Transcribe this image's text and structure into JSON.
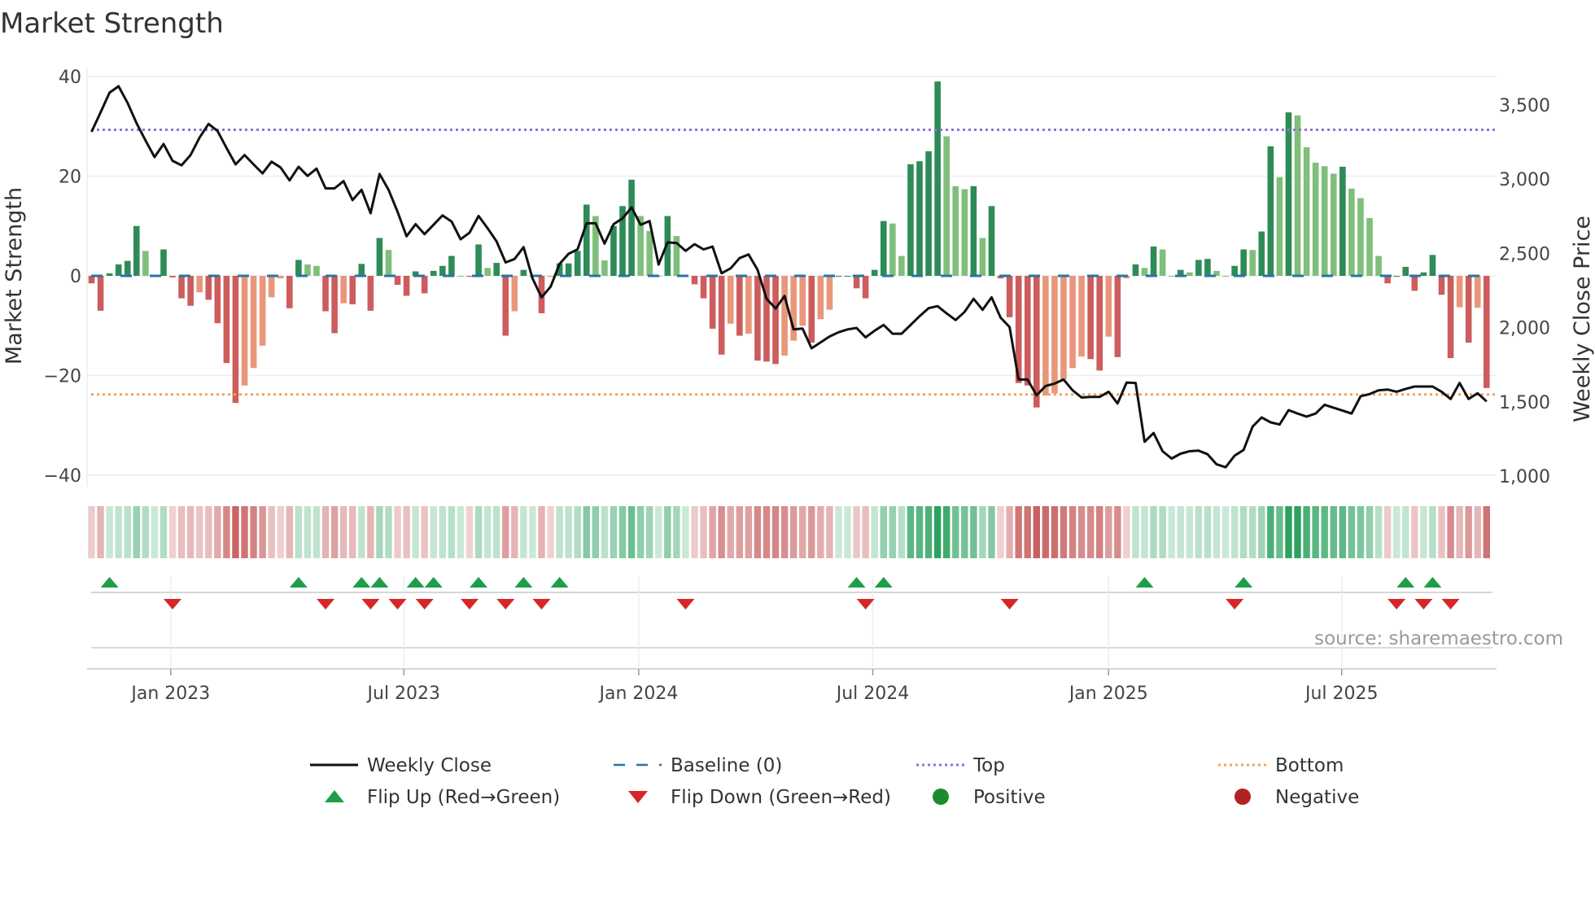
{
  "title": "Market Strength",
  "source": "source: sharemaestro.com",
  "colors": {
    "pos_strong": "#2e8b57",
    "pos_weak": "#7fbf7b",
    "neg_strong": "#cd5c5c",
    "neg_weak": "#e9967a",
    "close": "#111111",
    "baseline": "#2874a6",
    "top": "#9370db",
    "bottom": "#f0a35e",
    "flip_up": "#1e9e48",
    "flip_down": "#d62728",
    "positive": "#1e8a2e",
    "negative": "#b22222"
  },
  "chart_data": {
    "type": "bar+line",
    "title": "Market Strength",
    "ylabel": "Market Strength",
    "y2label": "Weekly Close Price",
    "ylim": [
      -42,
      42
    ],
    "y2lim": [
      1000,
      3700
    ],
    "yticks": [
      40,
      20,
      0,
      -20,
      -40
    ],
    "ytick_labels": [
      "40",
      "20",
      "0",
      "−20",
      "−40"
    ],
    "y2ticks": [
      3500,
      3000,
      2500,
      2000,
      1500,
      1000
    ],
    "y2tick_labels": [
      "3,500",
      "3,000",
      "2,500",
      "2,000",
      "1,500",
      "1,000"
    ],
    "xticks": [
      {
        "week": 8.8,
        "label": "Jan 2023"
      },
      {
        "week": 34.7,
        "label": "Jul 2023"
      },
      {
        "week": 60.8,
        "label": "Jan 2024"
      },
      {
        "week": 86.8,
        "label": "Jul 2024"
      },
      {
        "week": 113,
        "label": "Jan 2025"
      },
      {
        "week": 138.9,
        "label": "Jul 2025"
      }
    ],
    "top_level": 29.3,
    "bottom_level": -23.8,
    "baseline": 0,
    "strength": [
      -1.5,
      -7,
      0.5,
      2.3,
      3,
      10,
      5,
      0,
      5.3,
      -0.3,
      -4.5,
      -6,
      -3.3,
      -4.8,
      -9.5,
      -17.5,
      -25.5,
      -22,
      -18.5,
      -14,
      -4.3,
      -0.5,
      -6.5,
      3.2,
      2.3,
      2,
      -7.1,
      -11.5,
      -5.5,
      -5.7,
      2.4,
      -7,
      7.6,
      5.2,
      -1.8,
      -4,
      0.9,
      -3.5,
      1,
      2,
      4,
      0,
      -0.2,
      6.3,
      1.6,
      2.6,
      -12,
      -7.1,
      1.2,
      0,
      -7.5,
      -0.2,
      2.5,
      2.5,
      5,
      14.3,
      12,
      3.1,
      10,
      14,
      19.3,
      12,
      9,
      0,
      12,
      8,
      0,
      -1.7,
      -4.5,
      -10.6,
      -15.8,
      -9.6,
      -12,
      -11.6,
      -17,
      -17.2,
      -17.7,
      -16,
      -13,
      -10,
      -13.4,
      -8.7,
      -6.8,
      0,
      0,
      -2.5,
      -4.5,
      1.2,
      11,
      10.5,
      4,
      22.4,
      23,
      25,
      39,
      28,
      18,
      17.4,
      18,
      7.6,
      14,
      -0.5,
      -8.3,
      -21.5,
      -22,
      -26.4,
      -24,
      -23.6,
      -20.8,
      -18.5,
      -16.2,
      -16.7,
      -19,
      -12.2,
      -16.3,
      -0.5,
      2.3,
      1.6,
      5.9,
      5.3,
      0,
      1.2,
      0.7,
      3.2,
      3.4,
      1,
      0,
      2,
      5.3,
      5.2,
      8.9,
      26,
      19.8,
      32.8,
      32.2,
      25.8,
      22.7,
      22,
      20.5,
      21.9,
      17.5,
      15.6,
      11.6,
      4,
      -1.5,
      0,
      1.8,
      -3,
      0.7,
      4.2,
      -3.8,
      -16.5,
      -6.3,
      -13.4,
      -6.4,
      -22.5
    ],
    "weekly_close": [
      3319,
      3450,
      3583,
      3626,
      3515,
      3378,
      3260,
      3149,
      3237,
      3124,
      3094,
      3163,
      3280,
      3372,
      3325,
      3210,
      3100,
      3163,
      3100,
      3039,
      3118,
      3079,
      2992,
      3084,
      3022,
      3071,
      2938,
      2938,
      2987,
      2859,
      2928,
      2771,
      3035,
      2928,
      2781,
      2615,
      2697,
      2630,
      2693,
      2756,
      2715,
      2595,
      2640,
      2752,
      2670,
      2581,
      2439,
      2462,
      2542,
      2331,
      2204,
      2276,
      2429,
      2497,
      2527,
      2703,
      2703,
      2566,
      2697,
      2736,
      2810,
      2693,
      2718,
      2425,
      2574,
      2570,
      2517,
      2562,
      2527,
      2546,
      2366,
      2399,
      2468,
      2493,
      2390,
      2194,
      2129,
      2213,
      1988,
      1994,
      1861,
      1900,
      1940,
      1969,
      1988,
      1998,
      1934,
      1979,
      2018,
      1959,
      1959,
      2018,
      2077,
      2131,
      2145,
      2096,
      2051,
      2106,
      2194,
      2120,
      2204,
      2067,
      2004,
      1650,
      1650,
      1544,
      1607,
      1623,
      1650,
      1578,
      1529,
      1533,
      1533,
      1568,
      1489,
      1630,
      1627,
      1231,
      1290,
      1167,
      1118,
      1151,
      1167,
      1171,
      1147,
      1079,
      1059,
      1137,
      1176,
      1333,
      1395,
      1362,
      1347,
      1444,
      1421,
      1401,
      1421,
      1480,
      1460,
      1441,
      1421,
      1538,
      1552,
      1578,
      1583,
      1568,
      1587,
      1603,
      1603,
      1603,
      1568,
      1519,
      1627,
      1519,
      1558,
      1503
    ],
    "flip_up_weeks": [
      2,
      23,
      30,
      32,
      36,
      38,
      43,
      48,
      52,
      85,
      88,
      117,
      128,
      146,
      149
    ],
    "flip_down_weeks": [
      9,
      26,
      31,
      34,
      37,
      42,
      46,
      50,
      66,
      86,
      102,
      127,
      145,
      148,
      151
    ],
    "legend": [
      {
        "key": "close",
        "label": "Weekly Close"
      },
      {
        "key": "baseline",
        "label": "Baseline (0)"
      },
      {
        "key": "top",
        "label": "Top"
      },
      {
        "key": "bottom",
        "label": "Bottom"
      },
      {
        "key": "flip_up",
        "label": "Flip Up (Red→Green)"
      },
      {
        "key": "flip_down",
        "label": "Flip Down (Green→Red)"
      },
      {
        "key": "positive",
        "label": "Positive"
      },
      {
        "key": "negative",
        "label": "Negative"
      }
    ],
    "legend_position": "bottom"
  }
}
